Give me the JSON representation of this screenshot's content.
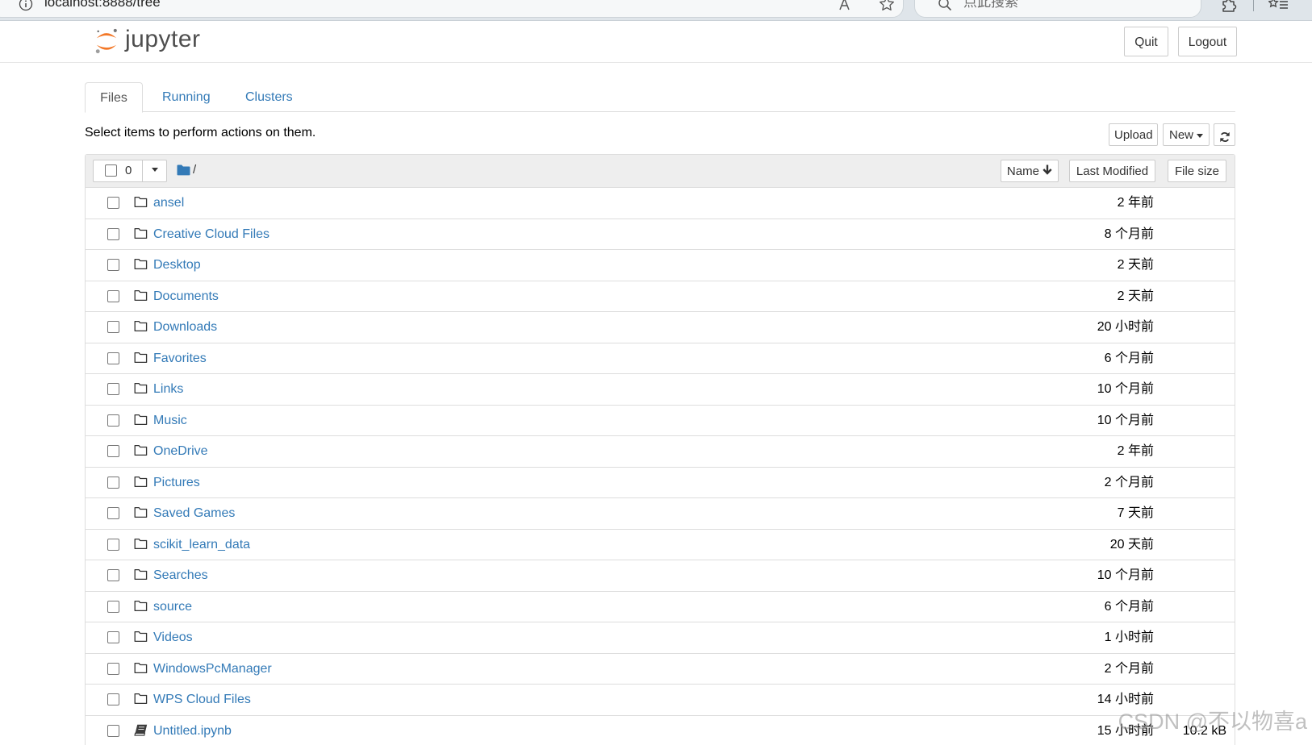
{
  "browser": {
    "url": "localhost:8888/tree",
    "search_placeholder": "点此搜索"
  },
  "header": {
    "logo_text": "jupyter",
    "quit_label": "Quit",
    "logout_label": "Logout"
  },
  "tabs": [
    {
      "label": "Files",
      "active": true
    },
    {
      "label": "Running",
      "active": false
    },
    {
      "label": "Clusters",
      "active": false
    }
  ],
  "toolbar": {
    "hint": "Select items to perform actions on them.",
    "upload_label": "Upload",
    "new_label": "New"
  },
  "list_header": {
    "selected_count": "0",
    "path": "/",
    "sort_name": "Name",
    "sort_last_modified": "Last Modified",
    "sort_file_size": "File size"
  },
  "items": [
    {
      "name": "ansel",
      "icon": "folder-icon",
      "modified": "2 年前"
    },
    {
      "name": "Creative Cloud Files",
      "icon": "folder-icon",
      "modified": "8 个月前"
    },
    {
      "name": "Desktop",
      "icon": "folder-icon",
      "modified": "2 天前"
    },
    {
      "name": "Documents",
      "icon": "folder-icon",
      "modified": "2 天前"
    },
    {
      "name": "Downloads",
      "icon": "folder-icon",
      "modified": "20 小时前"
    },
    {
      "name": "Favorites",
      "icon": "folder-icon",
      "modified": "6 个月前"
    },
    {
      "name": "Links",
      "icon": "folder-icon",
      "modified": "10 个月前"
    },
    {
      "name": "Music",
      "icon": "folder-icon",
      "modified": "10 个月前"
    },
    {
      "name": "OneDrive",
      "icon": "folder-icon",
      "modified": "2 年前"
    },
    {
      "name": "Pictures",
      "icon": "folder-icon",
      "modified": "2 个月前"
    },
    {
      "name": "Saved Games",
      "icon": "folder-icon",
      "modified": "7 天前"
    },
    {
      "name": "scikit_learn_data",
      "icon": "folder-icon",
      "modified": "20 天前"
    },
    {
      "name": "Searches",
      "icon": "folder-icon",
      "modified": "10 个月前"
    },
    {
      "name": "source",
      "icon": "folder-icon",
      "modified": "6 个月前"
    },
    {
      "name": "Videos",
      "icon": "folder-icon",
      "modified": "1 小时前"
    },
    {
      "name": "WindowsPcManager",
      "icon": "folder-icon",
      "modified": "2 个月前"
    },
    {
      "name": "WPS Cloud Files",
      "icon": "folder-icon",
      "modified": "14 小时前"
    },
    {
      "name": "Untitled.ipynb",
      "icon": "notebook-icon",
      "modified": "15 小时前",
      "size": "10.2 kB"
    }
  ],
  "colors": {
    "link": "#337ab7",
    "logo_orange": "#F37726"
  },
  "watermark": "CSDN @不以物喜a"
}
